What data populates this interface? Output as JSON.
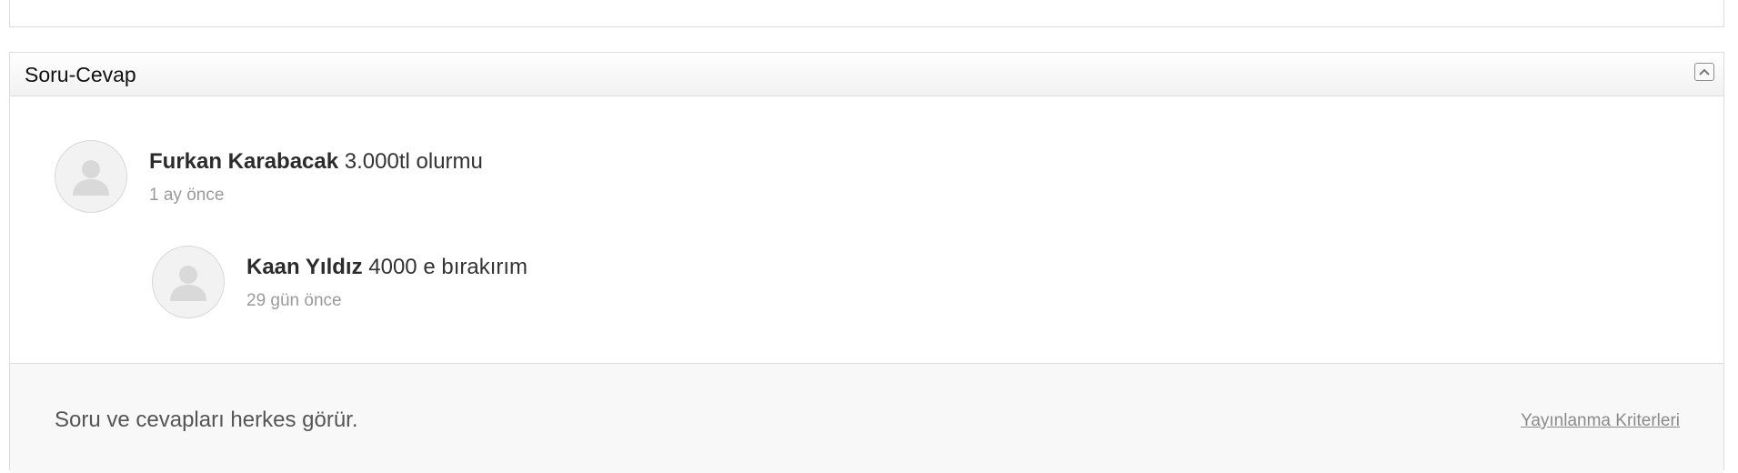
{
  "section": {
    "title": "Soru-Cevap",
    "collapse_icon": "chevron-up-icon"
  },
  "comments": [
    {
      "author": "Furkan Karabacak",
      "text": "3.000tl olurmu",
      "time": "1 ay önce",
      "avatar_icon": "user-placeholder-icon"
    },
    {
      "author": "Kaan Yıldız",
      "text": "4000 e bırakırım",
      "time": "29 gün önce",
      "avatar_icon": "user-placeholder-icon"
    }
  ],
  "footer": {
    "note": "Soru ve cevapları herkes görür.",
    "criteria_link": "Yayınlanma Kriterleri"
  }
}
